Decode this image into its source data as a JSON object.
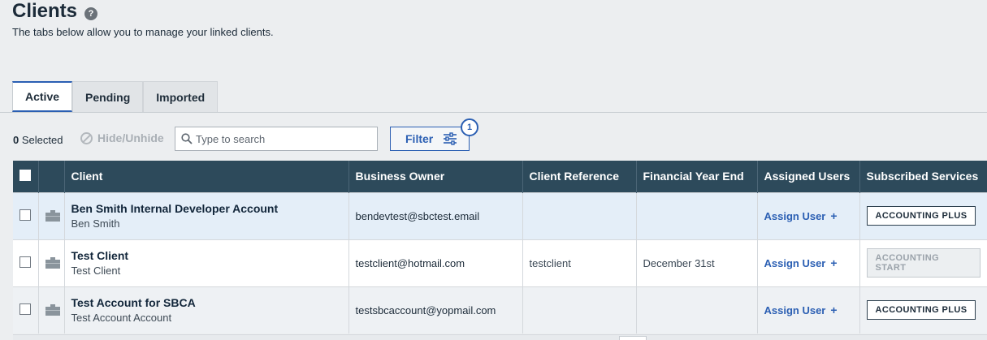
{
  "header": {
    "title": "Clients",
    "help_icon": "?",
    "subtitle": "The tabs below allow you to manage your linked clients."
  },
  "tabs": [
    {
      "label": "Active",
      "active": true
    },
    {
      "label": "Pending",
      "active": false
    },
    {
      "label": "Imported",
      "active": false
    }
  ],
  "toolbar": {
    "selected_count": "0",
    "selected_label": "Selected",
    "hide_unhide_label": "Hide/Unhide",
    "search_placeholder": "Type to search",
    "filter_label": "Filter",
    "filter_count": "1"
  },
  "table": {
    "columns": [
      "Client",
      "Business Owner",
      "Client Reference",
      "Financial Year End",
      "Assigned Users",
      "Subscribed Services"
    ],
    "rows": [
      {
        "name": "Ben Smith Internal Developer Account",
        "sub": "Ben Smith",
        "owner": "bendevtest@sbctest.email",
        "reference": "",
        "fye": "",
        "assign": "Assign User",
        "service": "ACCOUNTING PLUS",
        "service_muted": false
      },
      {
        "name": "Test Client",
        "sub": "Test Client",
        "owner": "testclient@hotmail.com",
        "reference": "testclient",
        "fye": "December 31st",
        "assign": "Assign User",
        "service": "ACCOUNTING START",
        "service_muted": true
      },
      {
        "name": "Test Account for SBCA",
        "sub": "Test Account Account",
        "owner": "testsbcaccount@yopmail.com",
        "reference": "",
        "fye": "",
        "assign": "Assign User",
        "service": "ACCOUNTING PLUS",
        "service_muted": false
      }
    ]
  },
  "colors": {
    "accent": "#2b5fb3",
    "header_bg": "#2d4a5b",
    "page_bg": "#eceef0"
  }
}
